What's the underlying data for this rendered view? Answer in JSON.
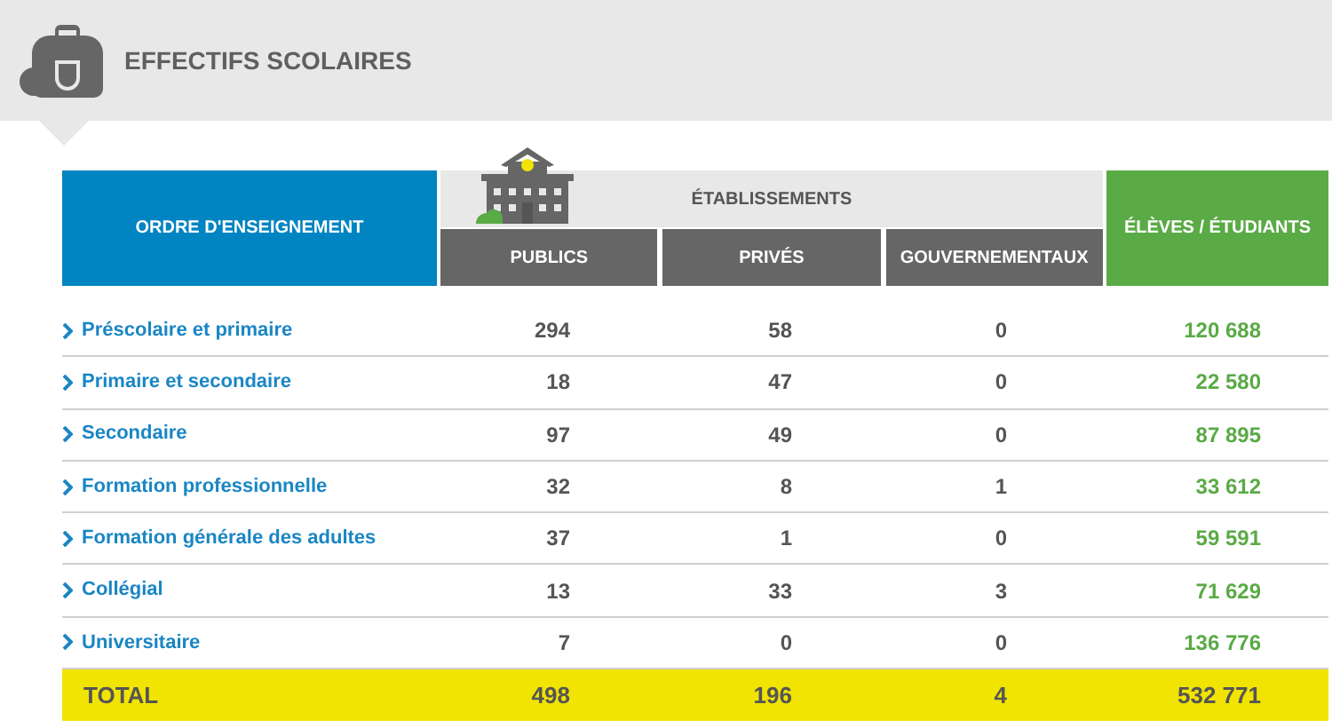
{
  "title": "EFFECTIFS SCOLAIRES",
  "table": {
    "columns": {
      "order": "ORDRE D'ENSEIGNEMENT",
      "group": "ÉTABLISSEMENTS",
      "sub": [
        "PUBLICS",
        "PRIVÉS",
        "GOUVERNEMENTAUX"
      ],
      "students": "ÉLÈVES / ÉTUDIANTS"
    },
    "rows": [
      {
        "label": "Préscolaire et primaire",
        "publics": "294",
        "prives": "58",
        "gouv": "0",
        "students": "120 688"
      },
      {
        "label": "Primaire et secondaire",
        "publics": "18",
        "prives": "47",
        "gouv": "0",
        "students": "22 580"
      },
      {
        "label": "Secondaire",
        "publics": "97",
        "prives": "49",
        "gouv": "0",
        "students": "87 895"
      },
      {
        "label": "Formation professionnelle",
        "publics": "32",
        "prives": "8",
        "gouv": "1",
        "students": "33 612"
      },
      {
        "label": "Formation générale des adultes",
        "publics": "37",
        "prives": "1",
        "gouv": "0",
        "students": "59 591"
      },
      {
        "label": "Collégial",
        "publics": "13",
        "prives": "33",
        "gouv": "3",
        "students": "71 629"
      },
      {
        "label": "Universitaire",
        "publics": "7",
        "prives": "0",
        "gouv": "0",
        "students": "136 776"
      }
    ],
    "total": {
      "label": "TOTAL",
      "publics": "498",
      "prives": "196",
      "gouv": "4",
      "students": "532 771"
    }
  }
}
